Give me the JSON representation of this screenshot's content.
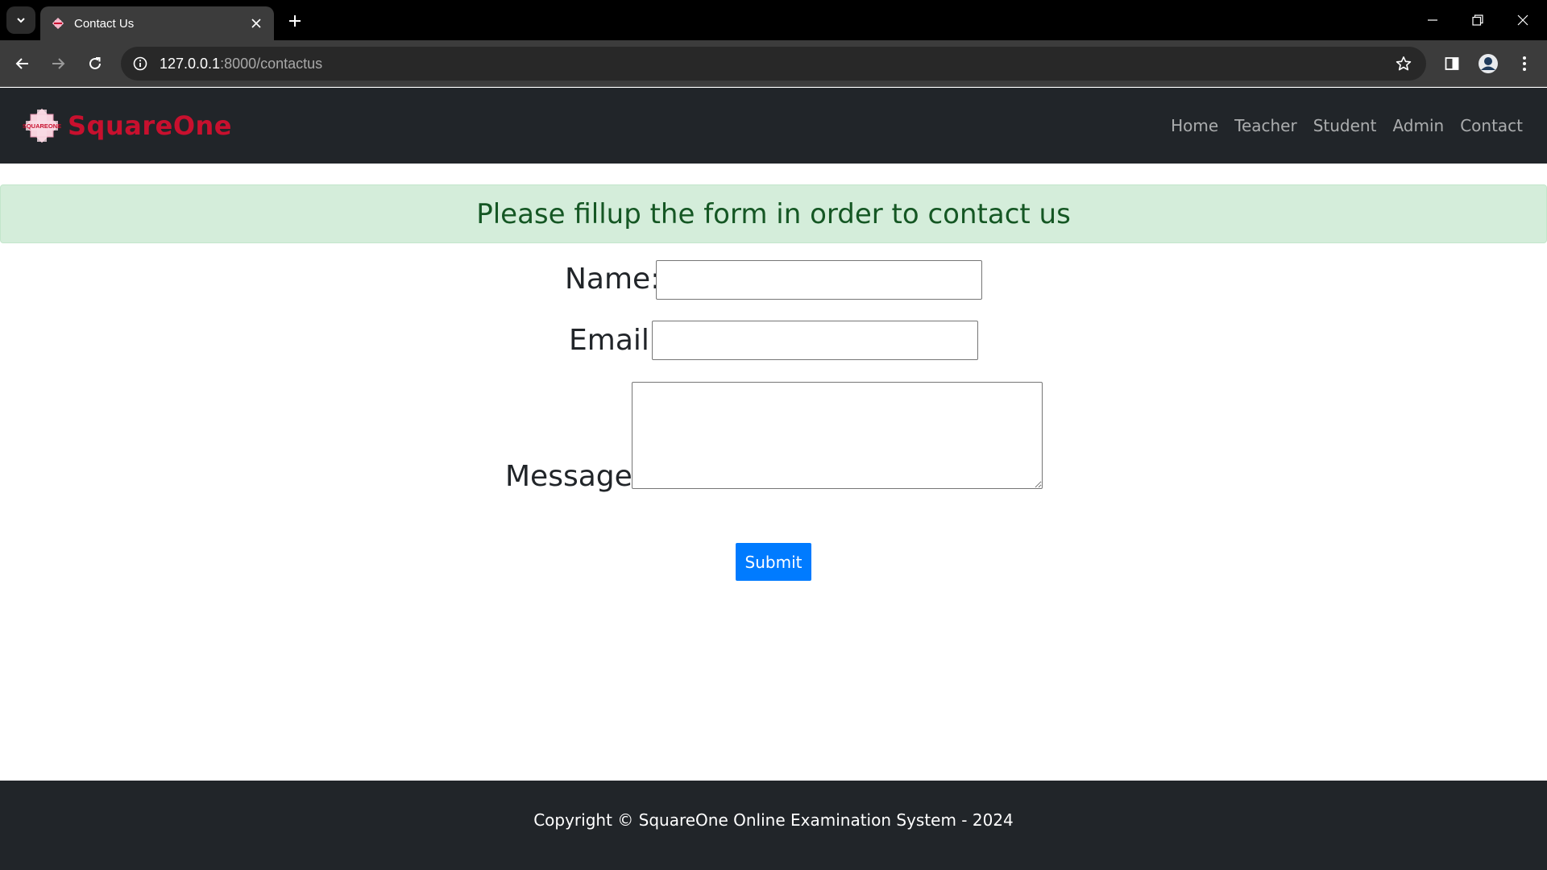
{
  "browser": {
    "tab_title": "Contact Us",
    "url_host": "127.0.0.1",
    "url_rest": ":8000/contactus",
    "icons": {
      "tab_search": "chevron-down-icon",
      "favicon": "squareone-favicon",
      "tab_close": "close-icon",
      "new_tab": "plus-icon",
      "minimize": "minimize-icon",
      "restore": "restore-icon",
      "close_window": "close-icon",
      "back": "arrow-left-icon",
      "forward": "arrow-right-icon",
      "reload": "reload-icon",
      "site_info": "info-icon",
      "bookmark": "star-icon",
      "side_panel": "side-panel-icon",
      "profile": "avatar-icon",
      "menu": "kebab-menu-icon"
    }
  },
  "navbar": {
    "brand": "SquareOne",
    "logo_text": "SQUAREONE",
    "links": [
      "Home",
      "Teacher",
      "Student",
      "Admin",
      "Contact"
    ]
  },
  "contact": {
    "alert": "Please fillup the form in order to contact us",
    "name_label": "Name:",
    "name_value": "",
    "email_label": "Email:",
    "email_value": "",
    "message_label": "Message:",
    "message_value": "",
    "submit_label": "Submit"
  },
  "footer": {
    "text": "Copyright © SquareOne Online Examination System - 2024"
  },
  "colors": {
    "navbar_bg": "#212529",
    "brand_red": "#c8102e",
    "alert_bg": "#d4edda",
    "alert_text": "#155724",
    "submit_bg": "#007bff"
  }
}
